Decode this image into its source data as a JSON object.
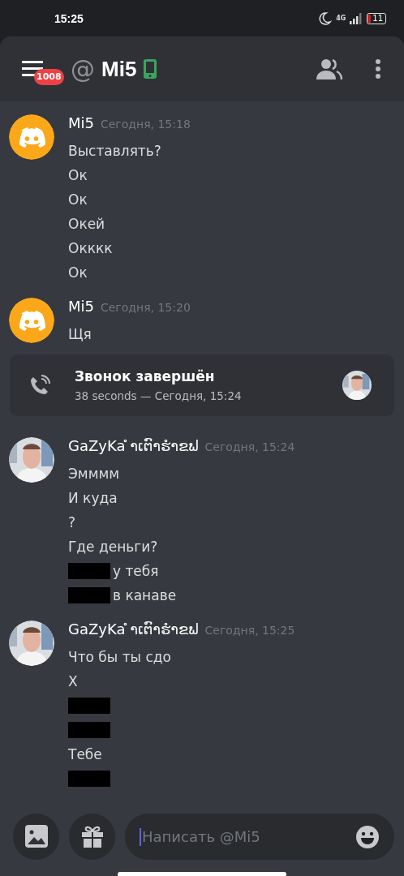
{
  "status_bar": {
    "time": "15:25",
    "network": "4G",
    "battery": "11"
  },
  "header": {
    "badge": "1008",
    "at": "@",
    "title": "Mi5"
  },
  "messages": [
    {
      "kind": "bot",
      "author": "Mi5",
      "time": "Сегодня, 15:18",
      "lines": [
        {
          "text": "Выставлять?",
          "redacted": false
        },
        {
          "text": "Ок",
          "redacted": false
        },
        {
          "text": "Ок",
          "redacted": false
        },
        {
          "text": "Окей",
          "redacted": false
        },
        {
          "text": "Окккк",
          "redacted": false
        },
        {
          "text": "Ок",
          "redacted": false
        }
      ]
    },
    {
      "kind": "bot",
      "author": "Mi5",
      "time": "Сегодня, 15:20",
      "lines": [
        {
          "text": "Щя",
          "redacted": false
        }
      ]
    },
    {
      "kind": "call",
      "title": "Звонок завершён",
      "detail": "38 seconds — Сегодня, 15:24"
    },
    {
      "author": "GaZyKa ໍາເຕົາຮໍາຂຟ",
      "time": "Сегодня, 15:24",
      "lines": [
        {
          "text": "Эмммм",
          "redacted": false
        },
        {
          "text": "И куда",
          "redacted": false
        },
        {
          "text": "?",
          "redacted": false
        },
        {
          "text": "Где деньги?",
          "redacted": false
        },
        {
          "text": "у тебя",
          "redacted": true
        },
        {
          "text": "в канаве",
          "redacted": true
        }
      ]
    },
    {
      "author": "GaZyKa ໍາເຕົາຮໍາຂຟ",
      "time": "Сегодня, 15:25",
      "lines": [
        {
          "text": "Что бы ты сдо",
          "redacted": false
        },
        {
          "text": "Х",
          "redacted": false
        },
        {
          "redacted": true
        },
        {
          "redacted": true
        },
        {
          "text": "Тебе",
          "redacted": false
        },
        {
          "redacted": true
        }
      ]
    }
  ],
  "composer": {
    "placeholder": "Написать @Mi5"
  }
}
